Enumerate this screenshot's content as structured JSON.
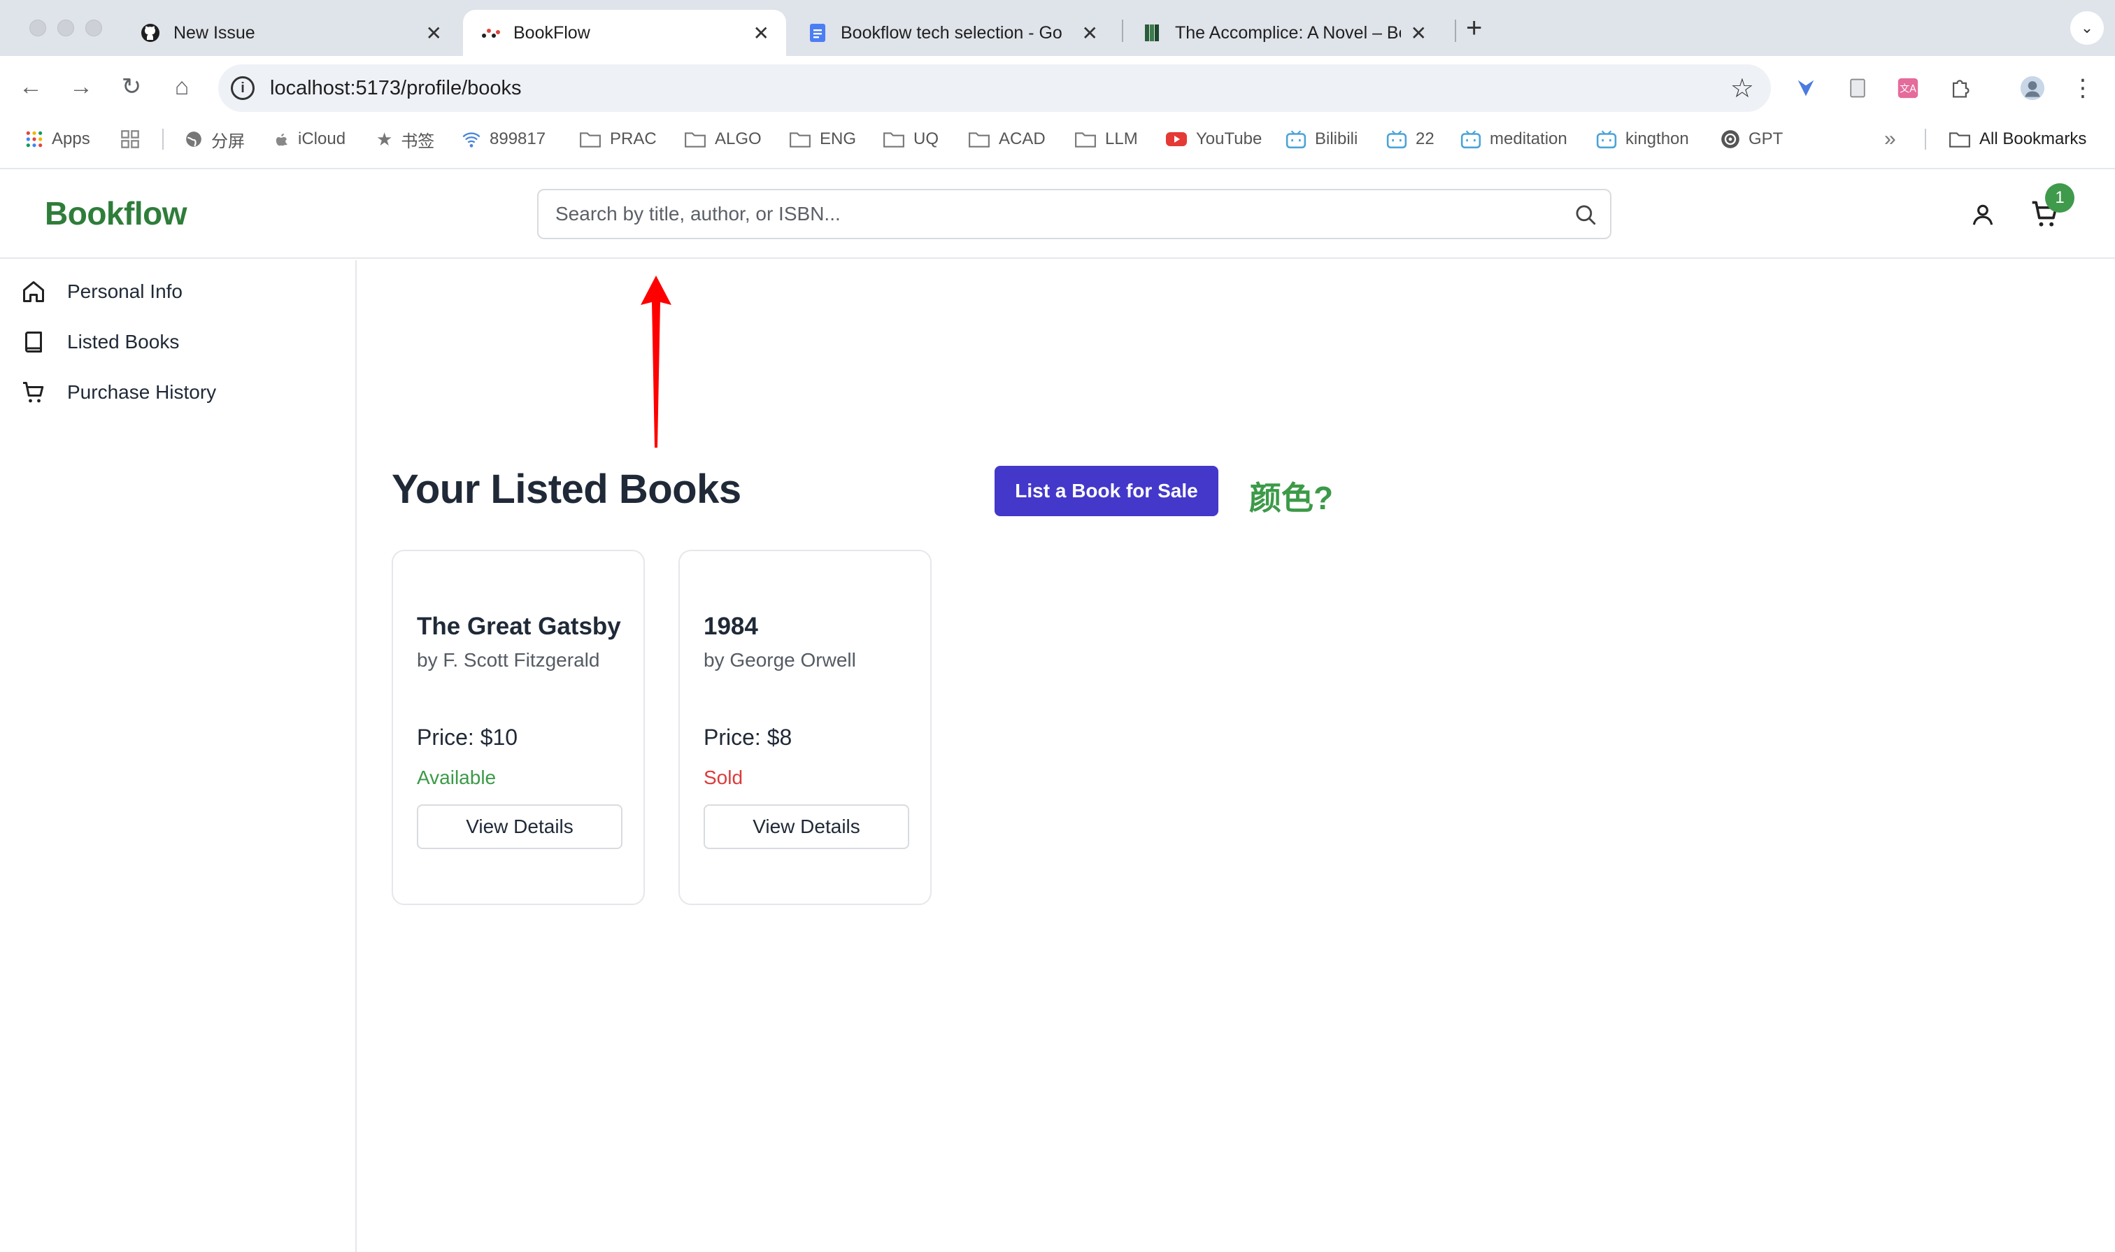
{
  "browser": {
    "tabs": [
      {
        "title": "New Issue",
        "icon": "github-icon",
        "active": false
      },
      {
        "title": "BookFlow",
        "icon": "bookflow-favicon",
        "active": true
      },
      {
        "title": "Bookflow tech selection - Go",
        "icon": "google-docs-icon",
        "active": false
      },
      {
        "title": "The Accomplice: A Novel – Bo",
        "icon": "book-favicon",
        "active": false
      }
    ],
    "new_tab": "+",
    "address": "localhost:5173/profile/books",
    "bookmarks": [
      {
        "label": "Apps",
        "icon": "apps-grid-icon"
      },
      {
        "label": "",
        "icon": "tab-groups-icon"
      },
      {
        "label": "分屏",
        "icon": "globe-icon"
      },
      {
        "label": "iCloud",
        "icon": "apple-icon"
      },
      {
        "label": "书签",
        "icon": "star-icon"
      },
      {
        "label": "899817",
        "icon": "wifi-icon"
      },
      {
        "label": "PRAC",
        "icon": "folder-icon"
      },
      {
        "label": "ALGO",
        "icon": "folder-icon"
      },
      {
        "label": "ENG",
        "icon": "folder-icon"
      },
      {
        "label": "UQ",
        "icon": "folder-icon"
      },
      {
        "label": "ACAD",
        "icon": "folder-icon"
      },
      {
        "label": "LLM",
        "icon": "folder-icon"
      },
      {
        "label": "YouTube",
        "icon": "youtube-icon"
      },
      {
        "label": "Bilibili",
        "icon": "bilibili-icon"
      },
      {
        "label": "22",
        "icon": "bilibili-icon"
      },
      {
        "label": "meditation",
        "icon": "bilibili-icon"
      },
      {
        "label": "kingthon",
        "icon": "bilibili-icon"
      },
      {
        "label": "GPT",
        "icon": "openai-icon"
      }
    ],
    "bookmarks_overflow": "»",
    "all_bookmarks": "All Bookmarks"
  },
  "app": {
    "logo": "Bookflow",
    "search_placeholder": "Search by title, author, or ISBN...",
    "cart_count": "1",
    "brand_color": "#2f7d3a",
    "accent_color": "#4338ca"
  },
  "sidebar": {
    "items": [
      {
        "label": "Personal Info",
        "icon": "home-icon"
      },
      {
        "label": "Listed Books",
        "icon": "book-icon"
      },
      {
        "label": "Purchase History",
        "icon": "cart-icon"
      }
    ]
  },
  "main": {
    "title": "Your Listed Books",
    "list_button": "List a Book for Sale",
    "books": [
      {
        "title": "The Great Gatsby",
        "author": "by F. Scott Fitzgerald",
        "price": "Price: $10",
        "status": "Available",
        "status_color": "#3c9a48",
        "button": "View Details"
      },
      {
        "title": "1984",
        "author": "by George Orwell",
        "price": "Price: $8",
        "status": "Sold",
        "status_color": "#dc3b3b",
        "button": "View Details"
      }
    ]
  },
  "annotation": {
    "text": "颜色?",
    "arrow_color": "#ff0000"
  }
}
